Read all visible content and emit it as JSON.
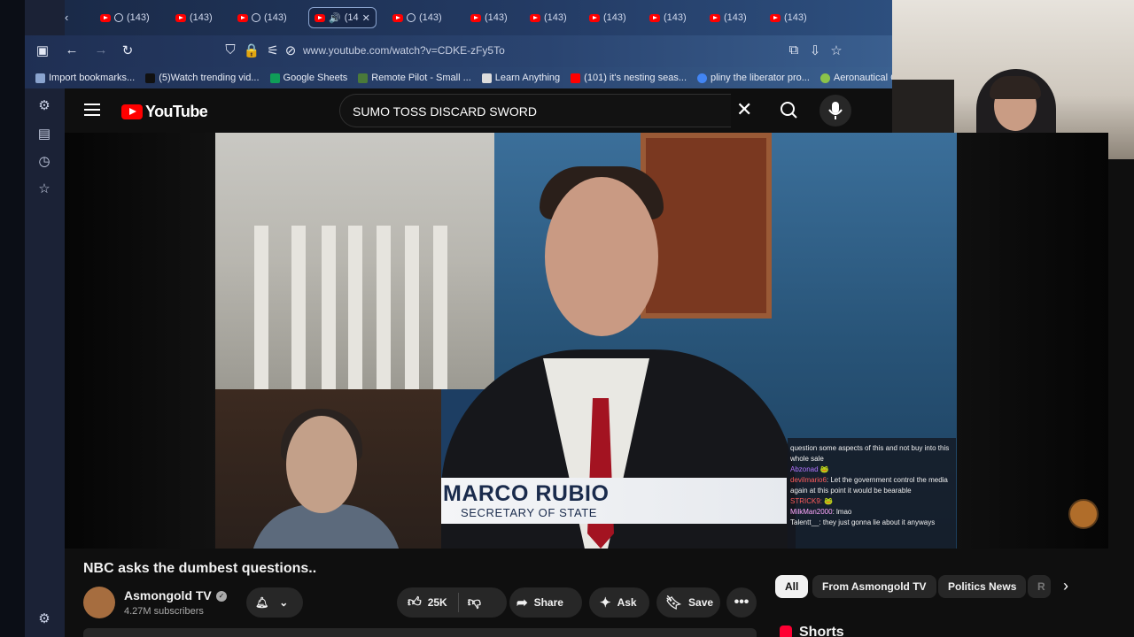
{
  "browser": {
    "tabs": [
      {
        "label": "(143)"
      },
      {
        "label": "(143)"
      },
      {
        "label": "(143)"
      },
      {
        "label": "(14"
      },
      {
        "label": "(143)"
      },
      {
        "label": "(143)"
      },
      {
        "label": "(143)"
      },
      {
        "label": "(143)"
      },
      {
        "label": "(143)"
      },
      {
        "label": "(143)"
      },
      {
        "label": "(143)"
      }
    ],
    "url": "www.youtube.com/watch?v=CDKE-zFy5To",
    "bookmarks": [
      {
        "label": "Import bookmarks...",
        "color": "#8aa4cf"
      },
      {
        "label": "(5)Watch trending vid...",
        "color": "#111111"
      },
      {
        "label": "Google Sheets",
        "color": "#0f9d58"
      },
      {
        "label": "Remote Pilot - Small ...",
        "color": "#4a7a3a"
      },
      {
        "label": "Learn Anything",
        "color": "#dddddd"
      },
      {
        "label": "(101) it's nesting seas...",
        "color": "#ff0000"
      },
      {
        "label": "pliny the liberator pro...",
        "color": "#4285f4"
      },
      {
        "label": "Aeronautical C",
        "color": "#8bc34a"
      }
    ]
  },
  "youtube": {
    "logo_text": "YouTube",
    "search_query": "SUMO TOSS DISCARD SWORD",
    "video": {
      "lower_third_name": "MARCO RUBIO",
      "lower_third_role": "SECRETARY OF STATE",
      "chat": [
        {
          "user": "",
          "text": "question some aspects of this and not buy into this whole sale"
        },
        {
          "user": "devilmario6",
          "text": "Let the government control the media again at this point it would be bearable"
        },
        {
          "user": "STRICK9:",
          "text": ""
        },
        {
          "user": "MilkMan2000",
          "text": "lmao"
        },
        {
          "user": "Talentt__",
          "text": "they just gonna lie about it anyways"
        }
      ]
    },
    "title": "NBC asks the dumbest questions..",
    "channel": {
      "name": "Asmongold TV",
      "subscribers": "4.27M subscribers"
    },
    "actions": {
      "likes": "25K",
      "share": "Share",
      "ask": "Ask",
      "save": "Save"
    },
    "chips": [
      "All",
      "From Asmongold TV",
      "Politics News",
      "R"
    ],
    "shorts_label": "Shorts"
  }
}
